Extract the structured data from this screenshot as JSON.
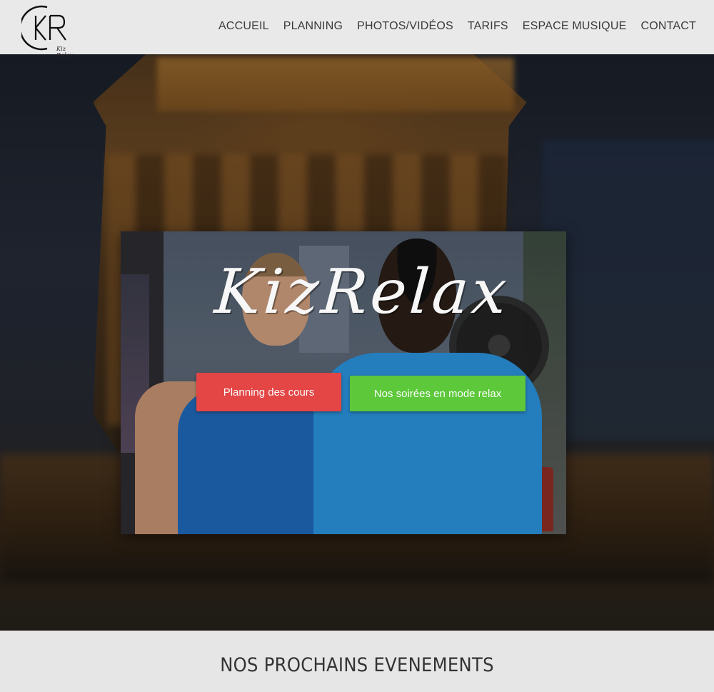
{
  "logo": {
    "text": "Kiz Relax"
  },
  "nav": {
    "items": [
      {
        "label": "ACCUEIL"
      },
      {
        "label": "PLANNING"
      },
      {
        "label": "PHOTOS/VIDÉOS"
      },
      {
        "label": "TARIFS"
      },
      {
        "label": "ESPACE MUSIQUE"
      },
      {
        "label": "CONTACT"
      }
    ]
  },
  "hero": {
    "brand_title": "KizRelax",
    "primary_button": "Planning des cours",
    "secondary_button": "Nos soirées en mode relax"
  },
  "section": {
    "title": "NOS PROCHAINS EVENEMENTS"
  },
  "colors": {
    "primary_button": "#e44545",
    "secondary_button": "#5cc83a",
    "header_bg": "#e9e9e9"
  }
}
